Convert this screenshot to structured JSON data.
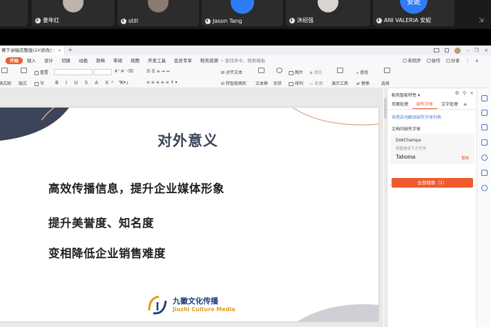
{
  "meeting": {
    "participants": [
      {
        "name": "姜年红",
        "avatar": "photo"
      },
      {
        "name": "still",
        "avatar": "photo"
      },
      {
        "name": "Jason Tang",
        "avatar": "blue"
      },
      {
        "name": "沐绍强",
        "avatar": "photo"
      },
      {
        "name": "ANI VALERIA 安妮",
        "avatar": "blue",
        "avatar_text": "安妮"
      }
    ]
  },
  "wps": {
    "doc_tab": "赛下讲稿完整版(2)(修改)",
    "menu": [
      "开始",
      "插入",
      "设计",
      "切换",
      "动画",
      "放映",
      "审阅",
      "视图",
      "开发工具",
      "会员专享",
      "稻壳资源"
    ],
    "search_placeholder": "查找命令、搜索模板",
    "menu_right": {
      "sync": "未同步",
      "collab": "协作",
      "share": "分享"
    },
    "toolbar": {
      "paste": "粘贴",
      "format_painter": "格式刷",
      "new_slide": "新建",
      "format": "版式",
      "section": "节",
      "reset": "重置",
      "text_align": "对齐文本",
      "smart_art": "转智能图形",
      "textbox": "文本框",
      "shape": "形状",
      "image": "图片",
      "arrange": "排列",
      "fill": "填充",
      "outline": "轮廓",
      "present_tools": "演示工具",
      "find": "查找",
      "replace": "替换",
      "select": "选择"
    },
    "format_glyphs": "B I U S A X² X₂",
    "colors": {
      "accent": "#f05a2e",
      "title": "#3b4458",
      "logo_blue": "#1e3a78",
      "logo_orange": "#e29a1f"
    }
  },
  "slide": {
    "title": "对外意义",
    "bullets": [
      "高效传播信息，提升企业媒体形象",
      "提升美誉度、知名度",
      "变相降低企业销售难度"
    ],
    "logo_cn": "九徽文化传播",
    "logo_en": "Jiuzhi Culture Media"
  },
  "panel": {
    "header": "稻壳智能特性",
    "tabs": [
      "页面处理",
      "缺失字体",
      "文字处理"
    ],
    "active_tab": 1,
    "link": "采用自动翻译缺失字体列表",
    "section_title": "文档内缺失字体",
    "missing_font": "DokChampa",
    "note": "将替换成下方字体",
    "replacement": "Tahoma",
    "replace_action": "替换",
    "replace_all": "全部替换（1）"
  }
}
